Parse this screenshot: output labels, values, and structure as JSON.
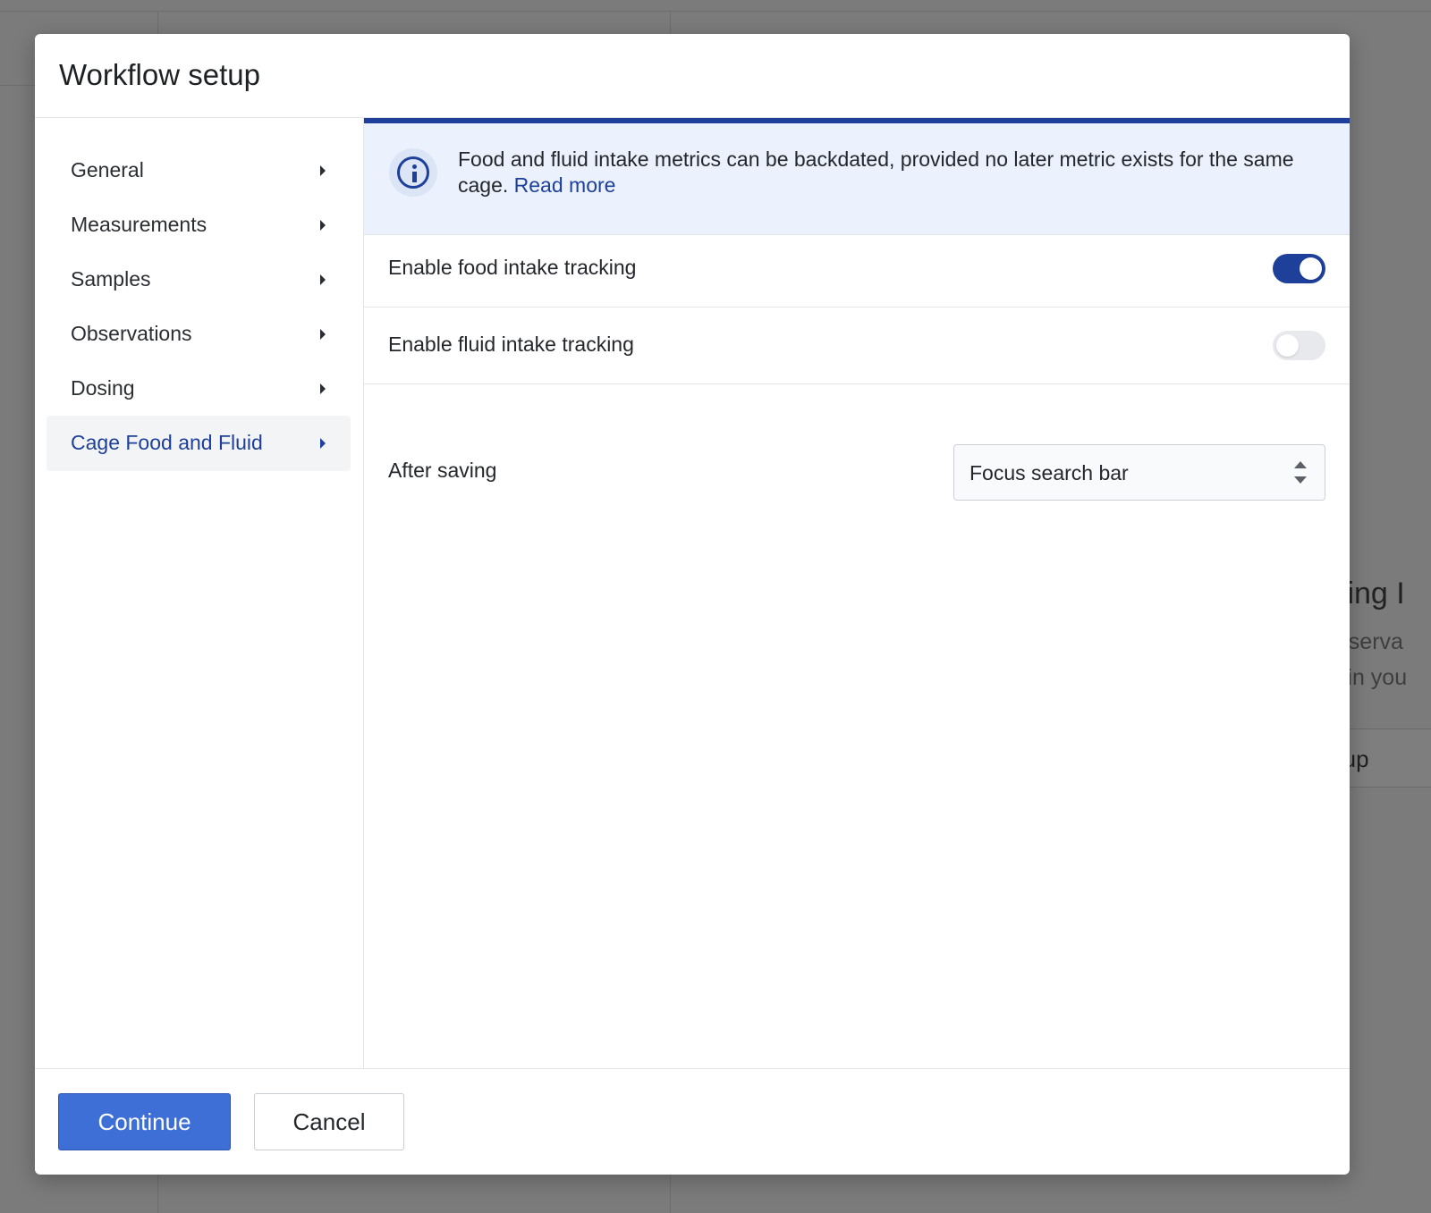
{
  "background": {
    "heading_fragment": "hling I",
    "desc_line1_fragment": "observa",
    "desc_line2_fragment": "al in you",
    "button_fragment": "etup"
  },
  "modal": {
    "title": "Workflow setup"
  },
  "sidebar": {
    "items": [
      {
        "label": "General",
        "active": false
      },
      {
        "label": "Measurements",
        "active": false
      },
      {
        "label": "Samples",
        "active": false
      },
      {
        "label": "Observations",
        "active": false
      },
      {
        "label": "Dosing",
        "active": false
      },
      {
        "label": "Cage Food and Fluid",
        "active": true
      }
    ]
  },
  "banner": {
    "text": "Food and fluid intake metrics can be backdated, provided no later metric exists for the same cage.",
    "link": "Read more",
    "icon": "info-icon"
  },
  "settings": {
    "food_label": "Enable food intake tracking",
    "food_enabled": true,
    "fluid_label": "Enable fluid intake tracking",
    "fluid_enabled": false,
    "after_saving_label": "After saving",
    "after_saving_value": "Focus search bar"
  },
  "footer": {
    "continue_label": "Continue",
    "cancel_label": "Cancel"
  },
  "colors": {
    "accent": "#1e3f9a",
    "primary_button": "#3d6fd6",
    "banner_bg": "#ebf2fd",
    "overlay": "#7b7b7b"
  }
}
